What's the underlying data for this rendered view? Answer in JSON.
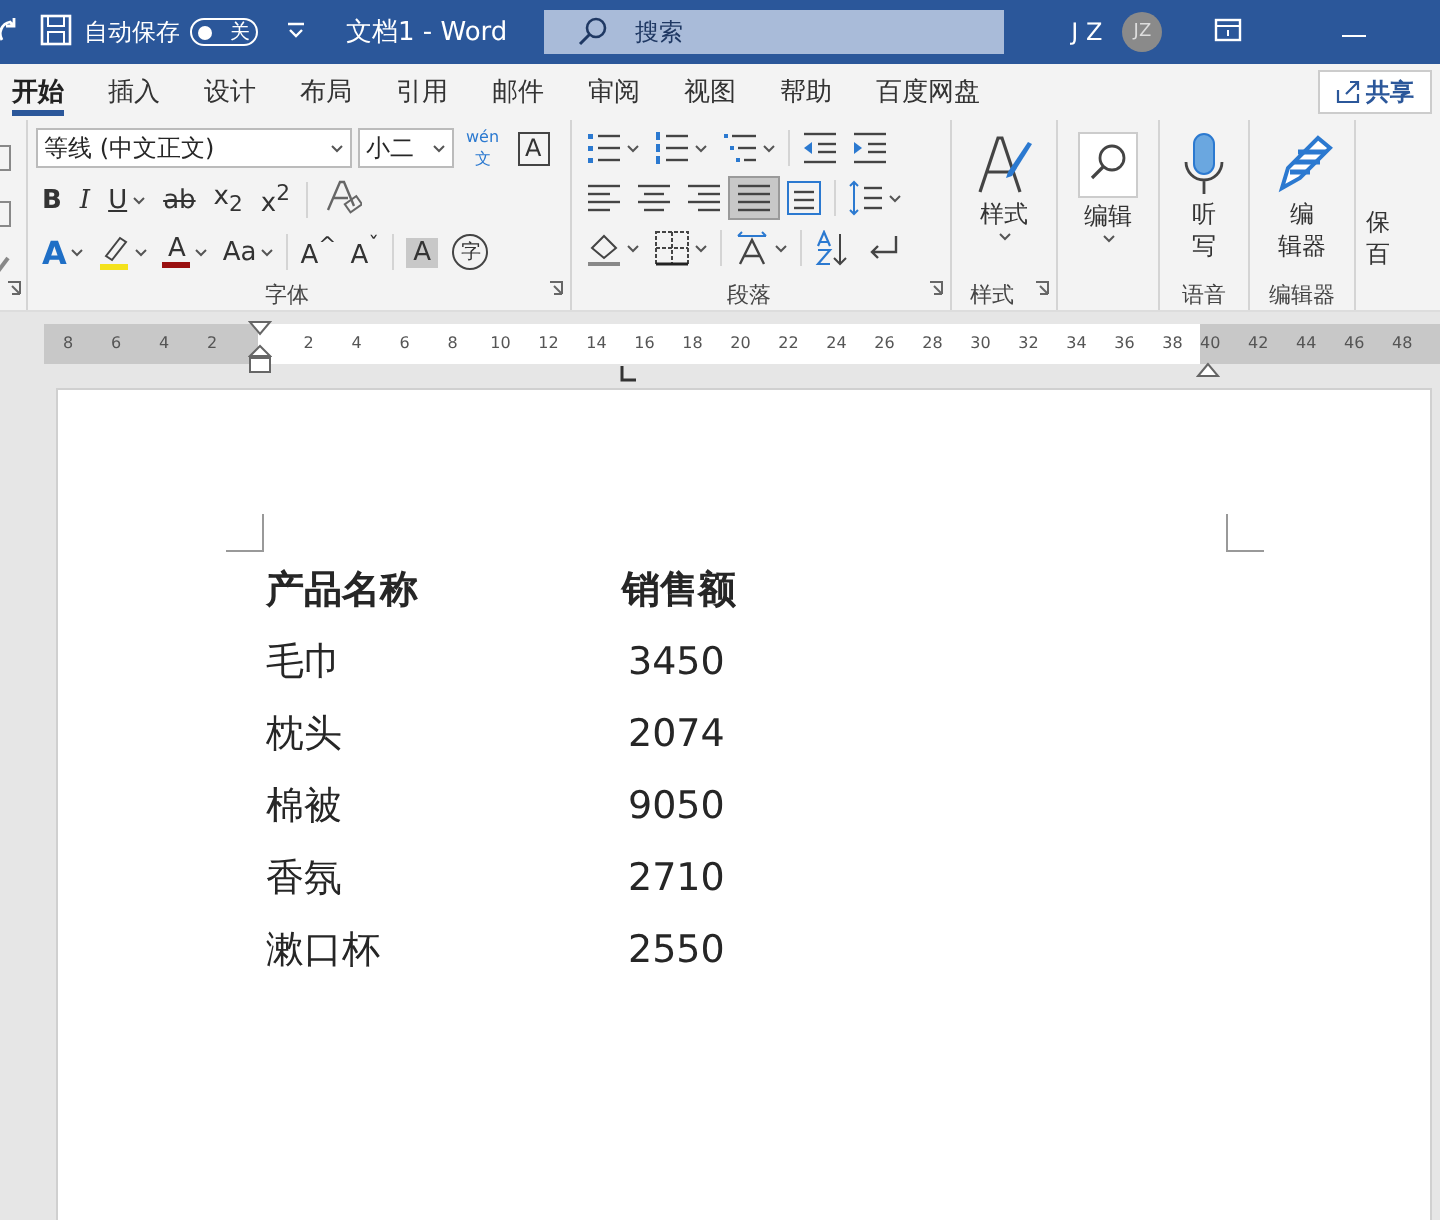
{
  "title_bar": {
    "autosave_label": "自动保存",
    "autosave": {
      "on": false,
      "label": "关"
    },
    "document_title": "文档1  -  Word",
    "search": {
      "placeholder": "搜索"
    },
    "user_initials": "J Z",
    "avatar": "JZ"
  },
  "tabs": [
    {
      "label": "开始",
      "selected": true
    },
    {
      "label": "插入",
      "selected": false
    },
    {
      "label": "设计",
      "selected": false
    },
    {
      "label": "布局",
      "selected": false
    },
    {
      "label": "引用",
      "selected": false
    },
    {
      "label": "邮件",
      "selected": false
    },
    {
      "label": "审阅",
      "selected": false
    },
    {
      "label": "视图",
      "selected": false
    },
    {
      "label": "帮助",
      "selected": false
    },
    {
      "label": "百度网盘",
      "selected": false
    }
  ],
  "share_button": "共享",
  "font_group": {
    "label": "字体",
    "font_name": "等线 (中文正文)",
    "font_size": "小二",
    "phonetic_guide": {
      "top": "wén",
      "bottom": "文"
    },
    "char_border": "A",
    "row_2": [
      {
        "kind": "bold",
        "label": "B",
        "dropdown": false
      },
      {
        "kind": "italic",
        "label": "I",
        "dropdown": false
      },
      {
        "kind": "underline",
        "label": "U",
        "dropdown": true
      },
      {
        "kind": "strike",
        "label": "ab",
        "dropdown": false
      },
      {
        "kind": "script",
        "label": "x$_{2}$",
        "dropdown": false
      },
      {
        "kind": "script",
        "label": "x$^{2}$",
        "dropdown": false
      }
    ],
    "row_3": [
      {
        "kind": "effects",
        "label": "A",
        "dropdown": true
      },
      {
        "kind": "highlight",
        "dropdown": true
      },
      {
        "kind": "font-color",
        "label": "A",
        "dropdown": true
      },
      {
        "kind": "case",
        "label": "Aa",
        "dropdown": true
      },
      {
        "kind": "grow",
        "label": "A$^{^}$",
        "dropdown": false
      },
      {
        "kind": "shrink",
        "label": "A$^{ˇ}$",
        "dropdown": false
      },
      {
        "kind": "shading",
        "label": "A",
        "dropdown": false
      },
      {
        "kind": "enclose",
        "label": "字",
        "dropdown": false
      }
    ]
  },
  "paragraph_group": {
    "label": "段落",
    "rows": [
      [
        {
          "kind": "bullets",
          "dropdown": true,
          "selected": false
        },
        {
          "kind": "numbering",
          "dropdown": true,
          "selected": false
        },
        {
          "kind": "multilevel",
          "dropdown": true,
          "selected": false
        },
        {
          "kind": "outdent",
          "dropdown": false,
          "selected": false
        },
        {
          "kind": "indent",
          "dropdown": false,
          "selected": false
        }
      ],
      [
        {
          "kind": "align-left",
          "dropdown": false,
          "selected": false
        },
        {
          "kind": "align-center",
          "dropdown": false,
          "selected": false
        },
        {
          "kind": "align-right",
          "dropdown": false,
          "selected": false
        },
        {
          "kind": "justify",
          "dropdown": false,
          "selected": true
        },
        {
          "kind": "distribute",
          "dropdown": false,
          "selected": false
        },
        {
          "kind": "line-spacing",
          "dropdown": true,
          "selected": false
        }
      ],
      [
        {
          "kind": "fill",
          "dropdown": true,
          "selected": false
        },
        {
          "kind": "borders",
          "dropdown": true,
          "selected": false
        },
        {
          "kind": "asian-layout",
          "dropdown": true,
          "selected": false
        },
        {
          "kind": "sort",
          "dropdown": false,
          "selected": false
        },
        {
          "kind": "marks",
          "dropdown": false,
          "selected": false
        }
      ]
    ]
  },
  "big_groups": [
    {
      "kind": "styles",
      "label": "样式",
      "lines": [
        "样式"
      ],
      "dropdown": true
    },
    {
      "kind": "editing",
      "lines": [
        "编辑"
      ],
      "dropdown": true
    },
    {
      "kind": "voice",
      "label": "语音",
      "lines": [
        "听",
        "写"
      ],
      "dropdown": false
    },
    {
      "kind": "editor",
      "label": "编辑器",
      "lines": [
        "编",
        "辑器"
      ],
      "dropdown": false
    },
    {
      "kind": "cut",
      "lines": [
        "保",
        "百"
      ],
      "dropdown": false
    }
  ],
  "ruler": {
    "left_labels": [
      "8",
      "6",
      "4",
      "2"
    ],
    "labels": [
      "2",
      "4",
      "6",
      "8",
      "10",
      "12",
      "14",
      "16",
      "18",
      "20",
      "22",
      "24",
      "26",
      "28",
      "30",
      "32",
      "34",
      "36",
      "38"
    ],
    "right_labels": [
      "40",
      "42",
      "44",
      "46",
      "48"
    ]
  },
  "document": {
    "table": {
      "columns": [
        "产品名称",
        "销售额"
      ],
      "rows": [
        [
          "毛巾",
          "3450"
        ],
        [
          "枕头",
          "2074"
        ],
        [
          "棉被",
          "9050"
        ],
        [
          "香氛",
          "2710"
        ],
        [
          "漱口杯",
          "2550"
        ]
      ]
    }
  }
}
